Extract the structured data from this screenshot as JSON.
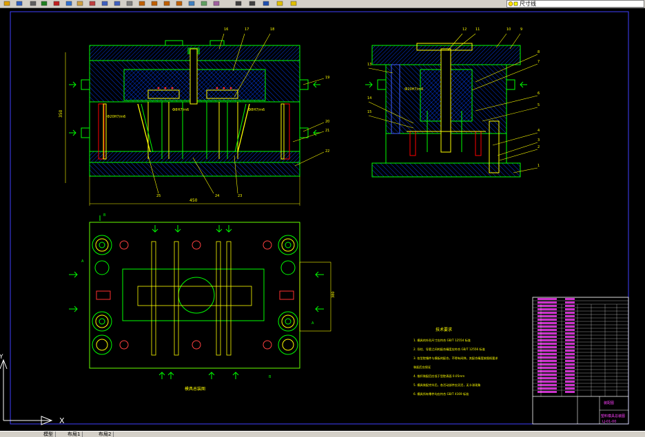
{
  "toolbar": {
    "buttons": [
      "open-icon",
      "save-icon",
      "print-icon",
      "preview-icon",
      "cut-icon",
      "copy-icon",
      "paste-icon",
      "match-icon",
      "undo-icon",
      "redo-icon",
      "pan-icon",
      "zoom-realtime-icon",
      "zoom-window-icon",
      "zoom-previous-icon",
      "zoom-extents-icon",
      "properties-icon",
      "design-center-icon",
      "tool-palette-icon",
      "text-style-icon",
      "table-icon",
      "help-icon",
      "layer-manager-icon",
      "layer-state-icon"
    ],
    "layer_value": "尺寸线"
  },
  "drawing": {
    "balloons_front": [
      "16",
      "17",
      "18",
      "19",
      "20",
      "21",
      "22",
      "25",
      "24",
      "23"
    ],
    "balloons_side": [
      "12",
      "11",
      "10",
      "9",
      "8",
      "7",
      "13",
      "6",
      "14",
      "5",
      "15",
      "4",
      "3",
      "2",
      "1"
    ],
    "fit_notes": [
      "Ф20H7/m6",
      "Ф8H7/m6",
      "Ф8H7/m6"
    ],
    "dims": {
      "width_front": "450",
      "height_front": "350",
      "side_dim": "380"
    },
    "section_labels": {
      "b_top": "B",
      "b_bottom": "B",
      "a_right": "A",
      "a_left": "A"
    },
    "plan_caption": "模具总装图",
    "notes_title": "技术要求",
    "notes": [
      "1. 模具的外形尺寸应符合 GB/T 12554 标准",
      "2. 导柱、导套之间的配合精度应符合 GB/T 12556 标准",
      "3. 各型腔镶件与模板的配合，不得有间隙，其配合精度按图纸要求",
      "   装配后应保证",
      "4. 推杆装配后应低于型腔表面 0.05mm",
      "5. 模具装配完毕后，各活动部件应灵活，无卡滞现象",
      "6. 模具所有零件均应符合 GB/T 4169 标准"
    ]
  },
  "title_block": {
    "name": "塑料模具总装图",
    "drawing_no": "LJ-01-00",
    "company": "装配图"
  },
  "ucs": {
    "x_label": "X",
    "y_label": "Y"
  },
  "command_tabs": [
    "模型",
    "布局1",
    "布局2"
  ]
}
